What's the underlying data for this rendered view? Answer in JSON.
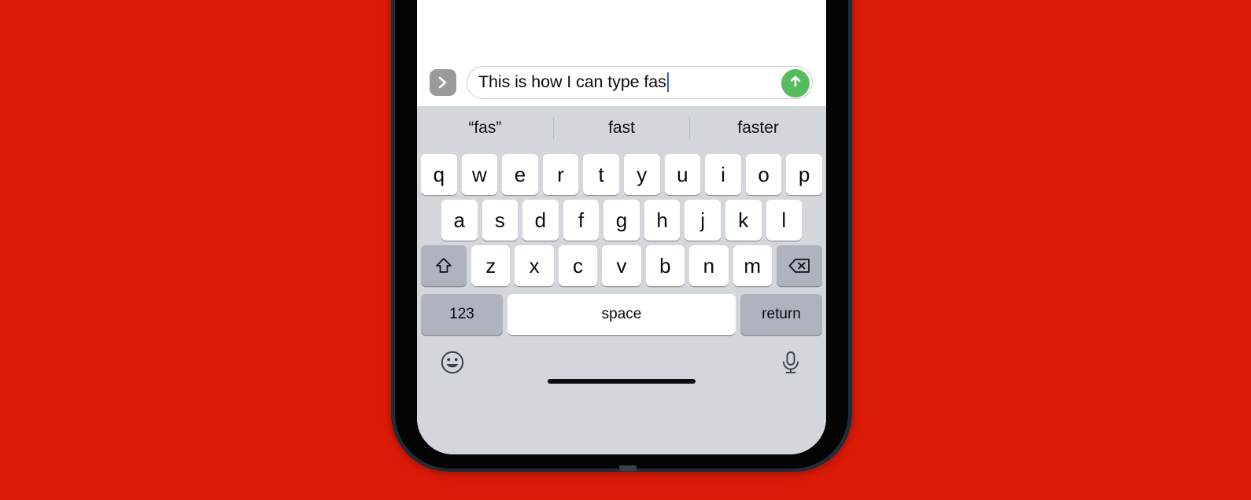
{
  "background": {
    "color": "#DC1A08"
  },
  "device": {
    "frame_color": "#1d2d3a",
    "bezel_color": "#040404",
    "screen_color": "#ffffff"
  },
  "input_bar": {
    "expand_button": {
      "icon": "chevron-right-icon",
      "color": "#9a9a9a"
    },
    "text_field": {
      "value": "This is how I can type fas",
      "placeholder": "iMessage",
      "caret_color": "#2f5fd4"
    },
    "send_button": {
      "icon": "arrow-up-icon",
      "color": "#56bb5c"
    }
  },
  "keyboard": {
    "background": "#D3D6DB",
    "predictions": [
      "“fas”",
      "fast",
      "faster"
    ],
    "row1": [
      "q",
      "w",
      "e",
      "r",
      "t",
      "y",
      "u",
      "i",
      "o",
      "p"
    ],
    "row2": [
      "a",
      "s",
      "d",
      "f",
      "g",
      "h",
      "j",
      "k",
      "l"
    ],
    "row3": [
      "z",
      "x",
      "c",
      "v",
      "b",
      "n",
      "m"
    ],
    "shift_key": {
      "icon": "shift-arrow-icon"
    },
    "backspace_key": {
      "icon": "backspace-delete-icon"
    },
    "row4": {
      "numbers_label": "123",
      "space_label": "space",
      "return_label": "return"
    },
    "footer": {
      "emoji_icon": "smiley-face-icon",
      "mic_icon": "microphone-icon"
    }
  }
}
